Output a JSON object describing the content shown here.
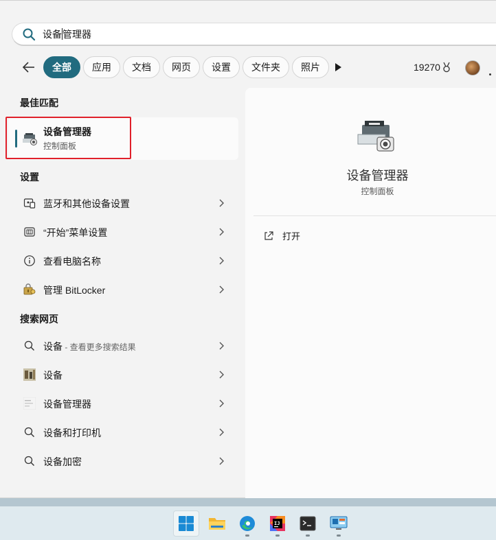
{
  "search": {
    "value": "设备管理器"
  },
  "filters": {
    "chips": [
      "全部",
      "应用",
      "文档",
      "网页",
      "设置",
      "文件夹",
      "照片"
    ],
    "active": "全部",
    "points": "19270"
  },
  "best_match": {
    "section_title": "最佳匹配",
    "title": "设备管理器",
    "subtitle": "控制面板"
  },
  "settings": {
    "section_title": "设置",
    "items": [
      {
        "label": "蓝牙和其他设备设置",
        "icon": "bluetooth-devices-icon"
      },
      {
        "label": "“开始”菜单设置",
        "icon": "start-menu-icon"
      },
      {
        "label": "查看电脑名称",
        "icon": "info-icon"
      },
      {
        "label": "管理 BitLocker",
        "icon": "bitlocker-icon"
      }
    ]
  },
  "web": {
    "section_title": "搜索网页",
    "items": [
      {
        "label": "设备",
        "sub": " - 查看更多搜索结果",
        "icon": "search-icon"
      },
      {
        "label": "设备",
        "sub": "",
        "icon": "web-thumbnail-icon"
      },
      {
        "label": "设备管理器",
        "sub": "",
        "icon": "web-thumbnail-icon"
      },
      {
        "label": "设备和打印机",
        "sub": "",
        "icon": "search-icon"
      },
      {
        "label": "设备加密",
        "sub": "",
        "icon": "search-icon"
      }
    ]
  },
  "preview": {
    "title": "设备管理器",
    "category": "控制面板",
    "action_open": "打开"
  },
  "taskbar": {
    "apps": [
      "start-icon",
      "file-explorer-icon",
      "edge-icon",
      "intellij-icon",
      "terminal-icon",
      "remote-desktop-icon"
    ]
  },
  "colors": {
    "accent": "#216b7f",
    "highlight_box": "#e0202a"
  }
}
